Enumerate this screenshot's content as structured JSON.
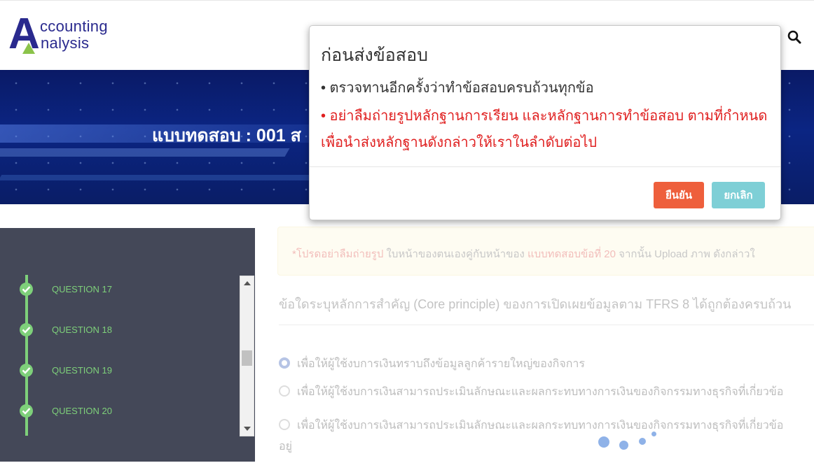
{
  "logo": {
    "letter": "A",
    "line1": "ccounting",
    "line2": "nalysis"
  },
  "icons": {
    "search": "search-icon",
    "check": "check-circle-icon"
  },
  "colors": {
    "brand": "#2a2a8e",
    "confirm": "#ee5f3c",
    "cancel": "#7ecfd6",
    "done": "#7ed07a",
    "warning": "#e02020"
  },
  "banner": {
    "title": "แบบทดสอบ : 001 ส"
  },
  "sidebar": {
    "questions": [
      {
        "label": "QUESTION 17",
        "completed": true
      },
      {
        "label": "QUESTION 18",
        "completed": true
      },
      {
        "label": "QUESTION 19",
        "completed": true
      },
      {
        "label": "QUESTION 20",
        "completed": true
      }
    ]
  },
  "main": {
    "alert": {
      "prefix": "*โปรดอย่าลืมถ่ายรูป",
      "middle": " ใบหน้าของตนเองคู่กับหน้าของ ",
      "highlight": "แบบทดสอบข้อที่ 20",
      "suffix": " จากนั้น Upload ภาพ ดังกล่าวใ"
    },
    "question": "ข้อใดระบุหลักการสำคัญ (Core principle) ของการเปิดเผยข้อมูลตาม TFRS 8 ได้ถูกต้องครบถ้วน",
    "choices": [
      {
        "text": "เพื่อให้ผู้ใช้งบการเงินทราบถึงข้อมูลลูกค้ารายใหญ่ของกิจการ",
        "selected": true
      },
      {
        "text": "เพื่อให้ผู้ใช้งบการเงินสามารถประเมินลักษณะและผลกระทบทางการเงินของกิจกรรมทางธุรกิจที่เกี่ยวข้อ",
        "selected": false
      },
      {
        "text": "เพื่อให้ผู้ใช้งบการเงินสามารถประเมินลักษณะและผลกระทบทางการเงินของกิจกรรมทางธุรกิจที่เกี่ยวข้อ",
        "selected": false
      }
    ],
    "choice_continuation": "อยู่"
  },
  "modal": {
    "title": "ก่อนส่งข้อสอบ",
    "line1": "• ตรวจทานอีกครั้งว่าทำข้อสอบครบถ้วนทุกข้อ",
    "warning": "• อย่าลืมถ่ายรูปหลักฐานการเรียน และหลักฐานการทำข้อสอบ ตามที่กำหนด เพื่อนำส่งหลักฐานดังกล่าวให้เราในลำดับต่อไป",
    "confirm_label": "ยืนยัน",
    "cancel_label": "ยกเลิก"
  }
}
